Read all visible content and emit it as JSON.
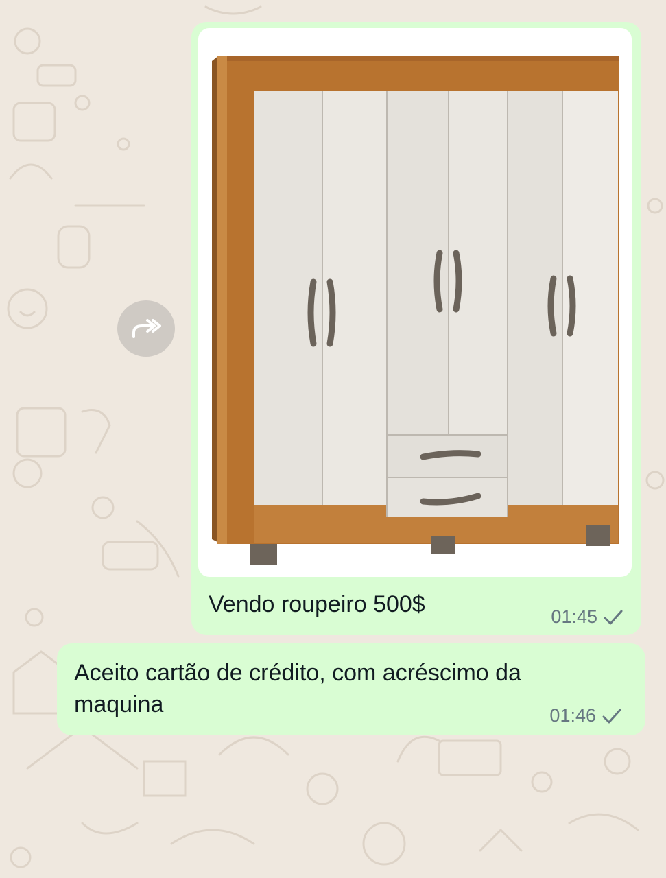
{
  "chat": {
    "messages": [
      {
        "type": "image",
        "caption": "Vendo roupeiro 500$",
        "time": "01:45",
        "status": "sent-check-icon"
      },
      {
        "type": "text",
        "text": "Aceito cartão de crédito, com acréscimo da maquina",
        "time": "01:46",
        "status": "sent-check-icon"
      }
    ],
    "forward_icon": "forward-icon"
  },
  "colors": {
    "background": "#efe8df",
    "outgoing_bubble": "#d9fdd3",
    "timestamp": "#667781",
    "wardrobe_wood": "#b8732f",
    "wardrobe_door": "#e8e5df"
  }
}
